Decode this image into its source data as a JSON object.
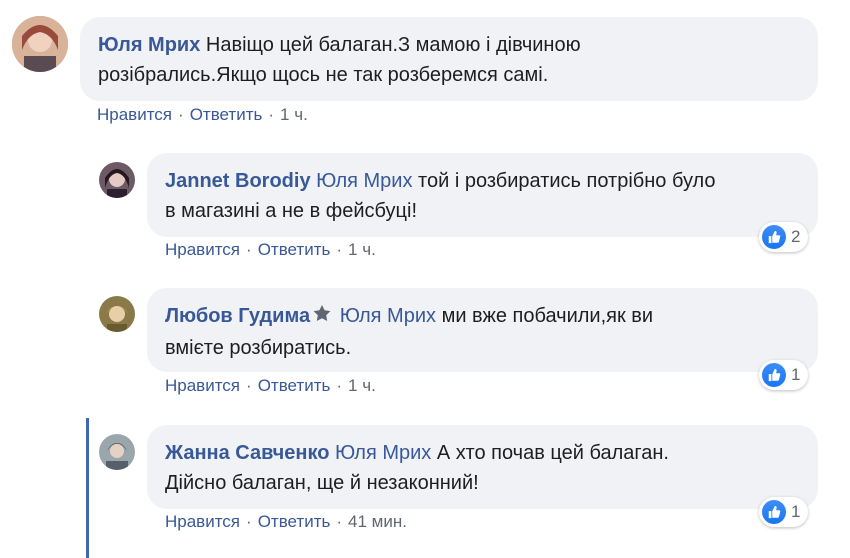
{
  "comments": [
    {
      "author": "Юля Мрих",
      "line1": "Навіщо цей балаган.З мамою і дівчиною",
      "line2": "розібрались.Якщо щось не так розберемся самі.",
      "like": "Нравится",
      "reply": "Ответить",
      "time": "1 ч.",
      "avatar_color": "#c98a6a"
    },
    {
      "author": "Jannet Borodiy",
      "mention": "Юля Мрих",
      "line1": "той і розбиратись потрібно було",
      "line2": "в магазині а не в фейсбуці!",
      "like": "Нравится",
      "reply": "Ответить",
      "time": "1 ч.",
      "reactions": "2",
      "avatar_color": "#3b2a3a"
    },
    {
      "author": "Любов Гудима",
      "mention": "Юля Мрих",
      "line1": "ми вже побачили,як ви",
      "line2": "вмієте розбиратись.",
      "like": "Нравится",
      "reply": "Ответить",
      "time": "1 ч.",
      "reactions": "1",
      "avatar_color": "#a89560"
    },
    {
      "author": "Жанна Савченко",
      "mention": "Юля Мрих",
      "line1": "А хто почав цей балаган.",
      "line2": "Дійсно балаган, ще й незаконний!",
      "like": "Нравится",
      "reply": "Ответить",
      "time": "41 мин.",
      "reactions": "1",
      "avatar_color": "#7c8a96"
    }
  ],
  "separator": "·",
  "colors": {
    "link": "#385898",
    "bubble": "#f0f2f5",
    "text": "#1c1e21",
    "meta": "#606770",
    "like_blue": "#1877f2",
    "thread_line": "#4267b2"
  },
  "icons": [
    "like-icon",
    "top-fan-badge-icon"
  ]
}
